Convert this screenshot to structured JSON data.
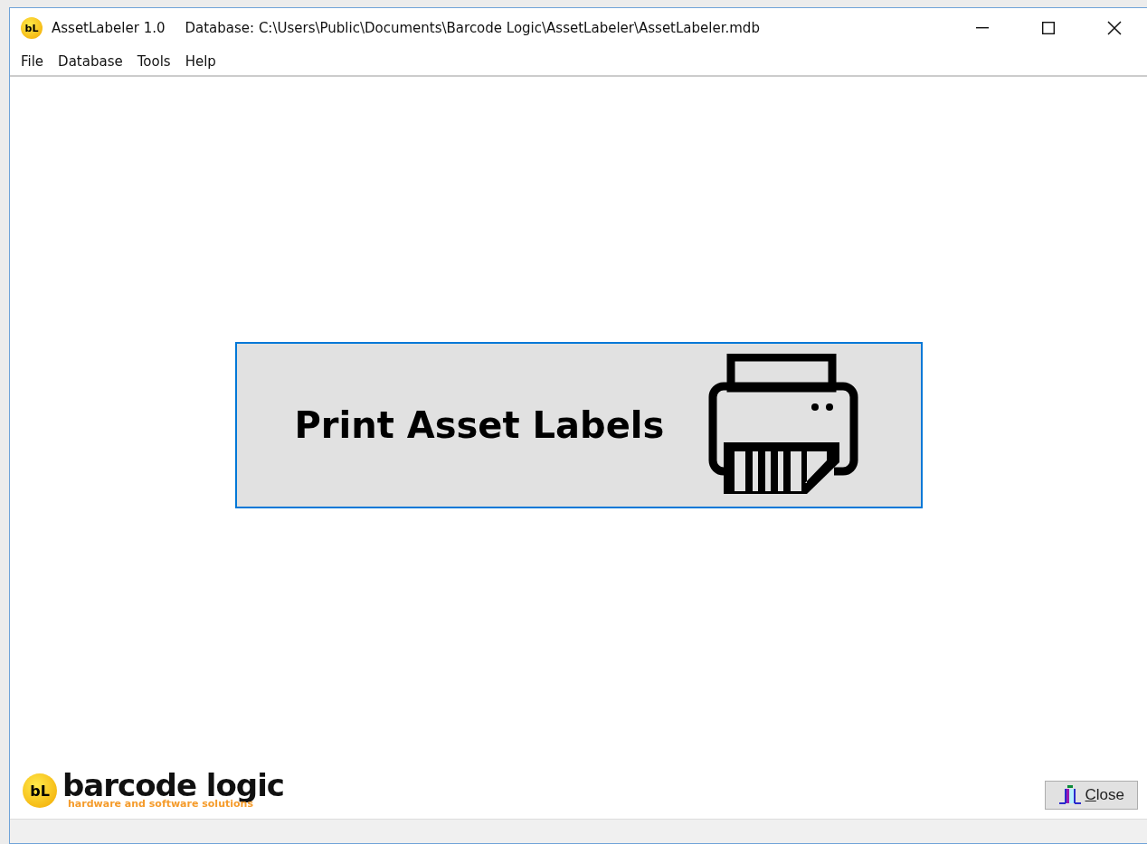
{
  "window": {
    "app_icon": "bL",
    "title": "AssetLabeler 1.0",
    "database": "Database: C:\\Users\\Public\\Documents\\Barcode Logic\\AssetLabeler\\AssetLabeler.mdb"
  },
  "menu": [
    "File",
    "Database",
    "Tools",
    "Help"
  ],
  "main_button": {
    "label": "Print Asset Labels",
    "focused": true
  },
  "logo": {
    "mark": "bL",
    "name": "barcode logic",
    "tagline": "hardware and software solutions"
  },
  "close_button": {
    "label": "Close"
  }
}
